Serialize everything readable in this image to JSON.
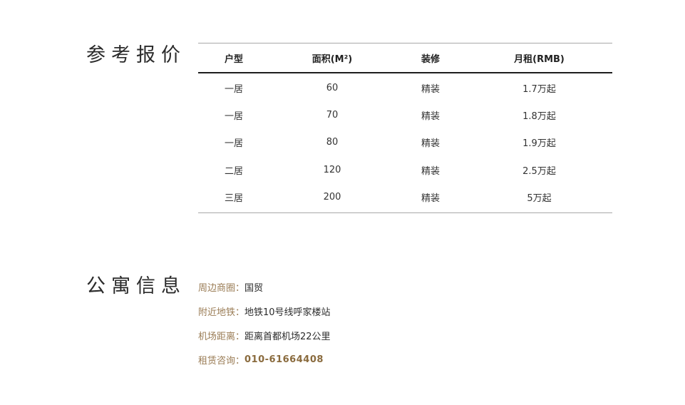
{
  "price_section": {
    "title": "参考报价",
    "headers": [
      "户型",
      "面积(M²)",
      "装修",
      "月租(RMB)"
    ],
    "rows": [
      [
        "一居",
        "60",
        "精装",
        "1.7万起"
      ],
      [
        "一居",
        "70",
        "精装",
        "1.8万起"
      ],
      [
        "一居",
        "80",
        "精装",
        "1.9万起"
      ],
      [
        "二居",
        "120",
        "精装",
        "2.5万起"
      ],
      [
        "三居",
        "200",
        "精装",
        "5万起"
      ]
    ]
  },
  "info_section": {
    "title": "公寓信息",
    "items": [
      {
        "label": "周边商圈：",
        "value": "国贸"
      },
      {
        "label": "附近地铁：",
        "value": "地铁10号线呼家楼站"
      },
      {
        "label": "机场距离：",
        "value": "距离首都机场22公里"
      },
      {
        "label": "租赁咨询：",
        "value": "010-61664408"
      }
    ]
  },
  "colors": {
    "label": "#9a7c55",
    "phone": "#8a6b3e",
    "rule": "#a8a8a8",
    "header_rule": "#1e1e1e"
  }
}
